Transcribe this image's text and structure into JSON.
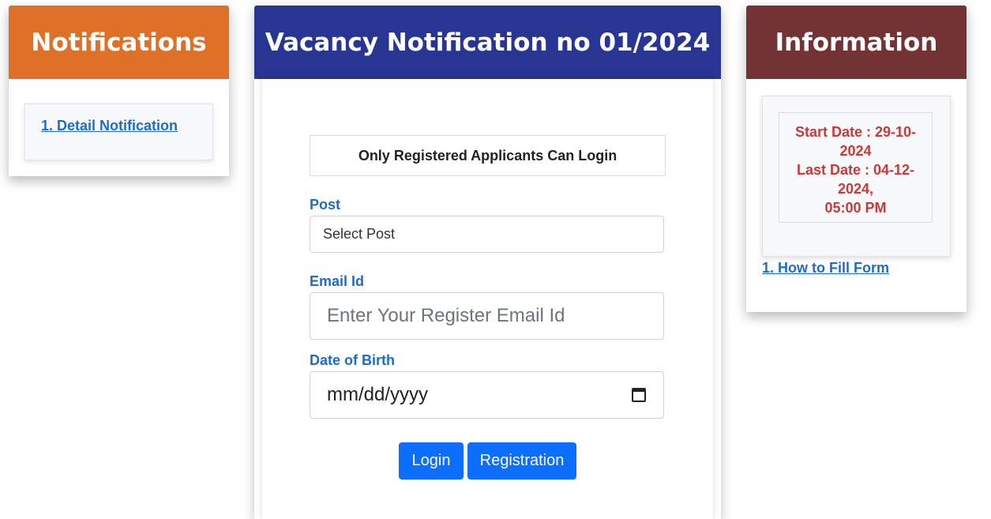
{
  "notifications": {
    "title": "Notifications",
    "link": "1. Detail Notification"
  },
  "main": {
    "title": "Vacancy Notification no 01/2024",
    "notice": "Only Registered Applicants Can Login",
    "post_label": "Post",
    "post_value": "Select Post",
    "email_label": "Email Id",
    "email_placeholder": "Enter Your Register Email Id",
    "dob_label": "Date of Birth",
    "dob_placeholder": "mm/dd/yyyy",
    "login_label": "Login",
    "registration_label": "Registration"
  },
  "information": {
    "title": "Information",
    "start_date": "Start Date : 29-10-2024",
    "last_date": "Last Date : 04-12-2024,",
    "last_time": "05:00 PM",
    "link": "1. How to Fill Form"
  },
  "colors": {
    "notifications_header": "#de7127",
    "main_header": "#283593",
    "information_header": "#733334",
    "link": "#1f6cc8",
    "button": "#0d6efd",
    "date_text": "#c83a3a"
  }
}
